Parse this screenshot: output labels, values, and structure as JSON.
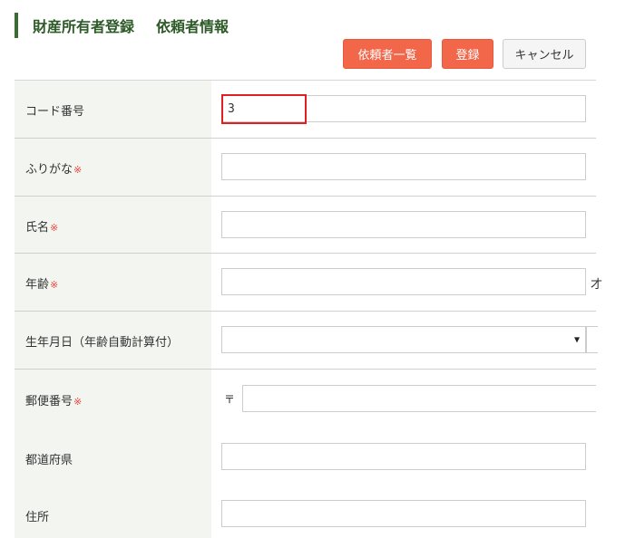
{
  "header": {
    "title_main": "財産所有者登録",
    "title_sub": "依頼者情報"
  },
  "toolbar": {
    "list_label": "依頼者一覧",
    "register_label": "登録",
    "cancel_label": "キャンセル"
  },
  "form": {
    "required_mark": "※",
    "code": {
      "label": "コード番号",
      "value": "3"
    },
    "furigana": {
      "label": "ふりがな",
      "value": ""
    },
    "name": {
      "label": "氏名",
      "value": ""
    },
    "age": {
      "label": "年齢",
      "value": "",
      "suffix": "才"
    },
    "birthdate": {
      "label": "生年月日（年齢自動計算付）",
      "value": ""
    },
    "postal": {
      "label": "郵便番号",
      "prefix": "〒",
      "value": ""
    },
    "prefecture": {
      "label": "都道府県",
      "value": ""
    },
    "address": {
      "label": "住所",
      "value": ""
    }
  },
  "colors": {
    "title_green": "#2d5a27",
    "accent_orange": "#f26649",
    "required_red": "#e8453c",
    "focus_red": "#e02020",
    "label_bg": "#f3f5f1"
  }
}
